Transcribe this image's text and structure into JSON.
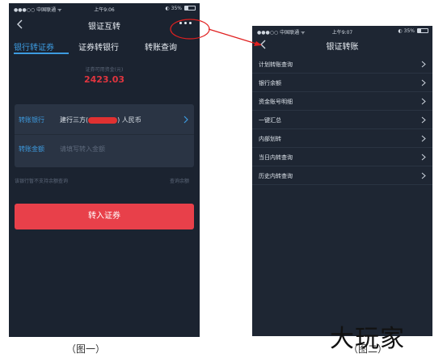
{
  "screen1": {
    "status": {
      "carrier": "●●●○○ 中国联通 ᯤ",
      "time": "上午9:06",
      "battery": "◐ 35%"
    },
    "title": "银证互转",
    "tabs": [
      "银行转证券",
      "证券转银行",
      "转账查询"
    ],
    "balance_label": "证券可用资金(元)",
    "balance_value": "2423.03",
    "form": {
      "bank_label": "转账银行",
      "bank_value_prefix": "建行三方(",
      "bank_value_suffix": ") 人民币",
      "amount_label": "转账金额",
      "amount_placeholder": "请填写转入金额"
    },
    "note": "该银行暂不支持余额查询",
    "note_link": "查询余额",
    "submit_label": "转入证券"
  },
  "screen2": {
    "status": {
      "carrier": "●●●○○ 中国联通 ᯤ",
      "time": "上午9:07",
      "battery": "◐ 35%"
    },
    "title": "银证转账",
    "menu": [
      "计划转账查询",
      "银行余额",
      "资金账号明细",
      "一键汇总",
      "内部划转",
      "当日内转查询",
      "历史内转查询"
    ]
  },
  "captions": [
    "（图一）",
    "（图二）"
  ],
  "watermark": "大玩家",
  "colors": {
    "accent_blue": "#3d9be0",
    "submit_red": "#e8404a",
    "annotation_red": "#e02020",
    "balance_red": "#e0353f"
  }
}
